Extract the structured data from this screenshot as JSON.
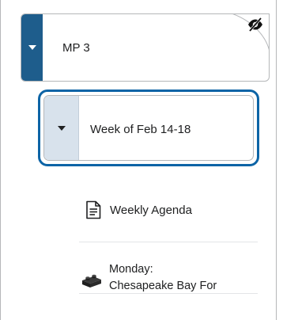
{
  "module": {
    "title": "MP 3",
    "visibility_icon": "eye-slash-icon",
    "toggle_icon": "caret-down-icon",
    "accent_color": "#1e5d8c"
  },
  "submodule": {
    "title": "Week of Feb 14-18",
    "toggle_icon": "caret-down-icon",
    "focus_color": "#0d64a6"
  },
  "topics": [
    {
      "icon": "document-icon",
      "label": "Weekly Agenda"
    },
    {
      "icon": "lego-brick-icon",
      "label_line1": "Monday:",
      "label_line2": "Chesapeake Bay For"
    }
  ]
}
